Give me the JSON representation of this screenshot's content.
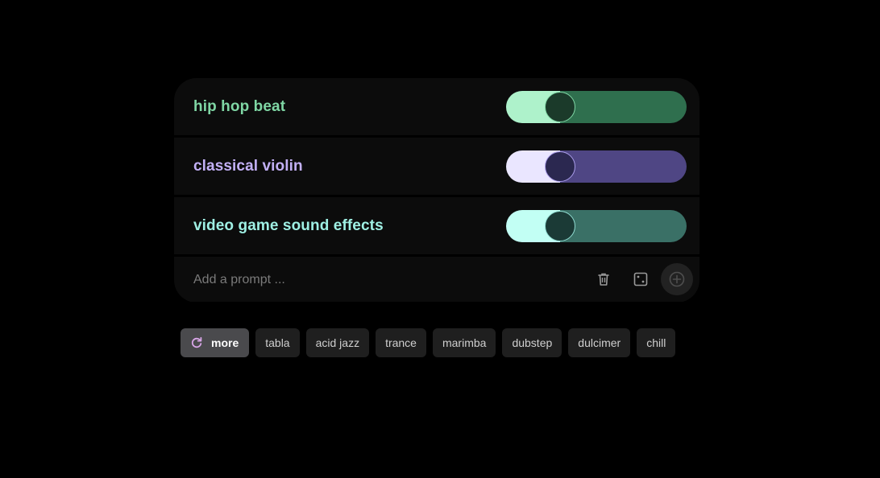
{
  "prompts": [
    {
      "label": "hip hop beat",
      "level": 0.3,
      "colors": {
        "text": "#7fd6a4",
        "fill": "#aef2cb",
        "track": "#2f6f4e",
        "knob": "#1b3a2a",
        "knob_border": "#7fd6a4"
      }
    },
    {
      "label": "classical violin",
      "level": 0.3,
      "colors": {
        "text": "#c2b0f5",
        "fill": "#eae6ff",
        "track": "#4f4684",
        "knob": "#2b2850",
        "knob_border": "#a89be8"
      }
    },
    {
      "label": "video game sound effects",
      "level": 0.3,
      "colors": {
        "text": "#9ff0e4",
        "fill": "#c2fff4",
        "track": "#3a7066",
        "knob": "#1b3a36",
        "knob_border": "#8fdad0"
      }
    }
  ],
  "prompt_input": {
    "placeholder": "Add a prompt ...",
    "value": ""
  },
  "actions": {
    "delete_icon": "trash-icon",
    "random_icon": "dice-icon",
    "add_icon": "plus-circle-icon"
  },
  "suggestions": {
    "more_label": "more",
    "more_icon": "refresh-icon",
    "more_icon_color": "#d9a6e8",
    "chips": [
      "tabla",
      "acid jazz",
      "trance",
      "marimba",
      "dubstep",
      "dulcimer",
      "chill"
    ]
  }
}
